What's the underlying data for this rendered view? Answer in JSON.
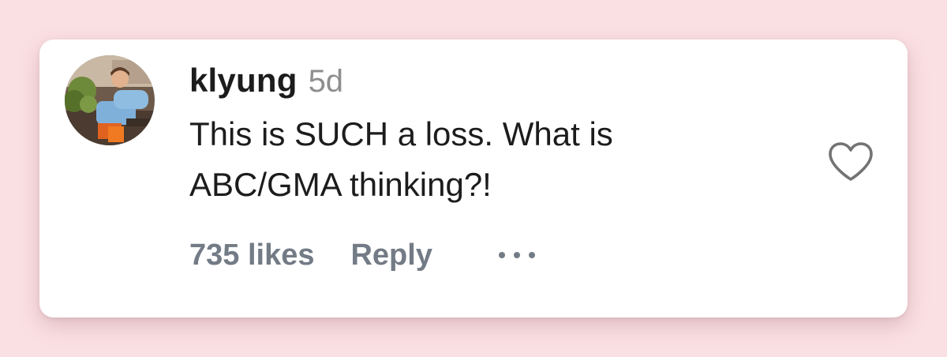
{
  "comment": {
    "username": "klyung",
    "timestamp": "5d",
    "text": "This is SUCH a loss. What is ABC/GMA thinking?!",
    "likes_label": "735 likes",
    "reply_label": "Reply",
    "avatar": "user-photo-avatar",
    "like_icon": "heart-outline-icon",
    "more_icon": "more-options-icon"
  },
  "colors": {
    "background": "#fbe0e3",
    "card": "#ffffff",
    "text": "#1c1c1c",
    "muted": "#737b86",
    "timestamp": "#8e8e8e"
  }
}
